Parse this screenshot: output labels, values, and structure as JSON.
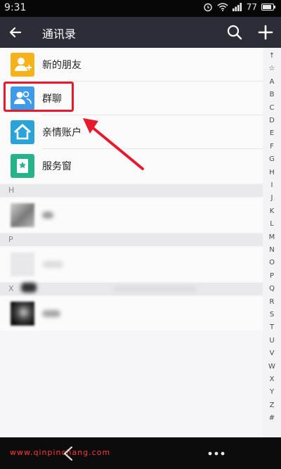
{
  "status_bar": {
    "time": "9:31",
    "battery": "77"
  },
  "header": {
    "title": "通讯录",
    "back_icon": "arrow-left-icon",
    "search_icon": "search-icon",
    "add_icon": "plus-icon"
  },
  "items": [
    {
      "label": "新的朋友",
      "icon": "new-friend-icon",
      "color": "#f5b21b"
    },
    {
      "label": "群聊",
      "icon": "group-chat-icon",
      "color": "#3d9be9"
    },
    {
      "label": "亲情账户",
      "icon": "family-account-icon",
      "color": "#2aa3d8"
    },
    {
      "label": "服务窗",
      "icon": "service-window-icon",
      "color": "#26b38a"
    }
  ],
  "sections": [
    "H",
    "P",
    "X"
  ],
  "index_letters": [
    "↑",
    "☆",
    "A",
    "B",
    "C",
    "D",
    "E",
    "F",
    "G",
    "H",
    "I",
    "J",
    "K",
    "L",
    "M",
    "N",
    "O",
    "P",
    "Q",
    "R",
    "S",
    "T",
    "U",
    "V",
    "W",
    "X",
    "Y",
    "Z",
    "#"
  ],
  "bottom_bar": {
    "watermark": "www.qinpinchang.com",
    "more_icon": "more-dots-icon"
  },
  "annotation": {
    "highlight_color": "#e6192d"
  }
}
